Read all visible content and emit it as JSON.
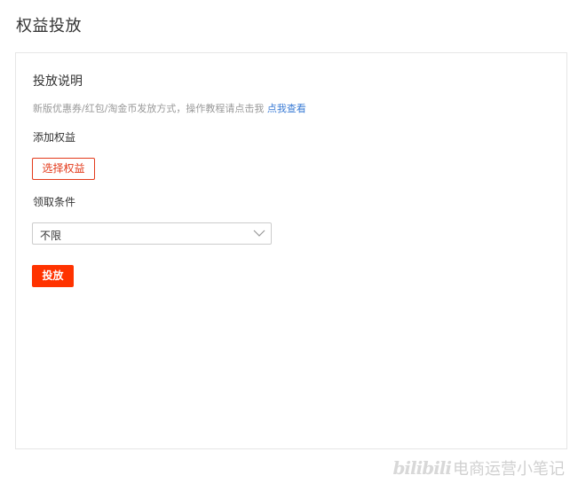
{
  "page": {
    "title": "权益投放"
  },
  "card": {
    "section_title": "投放说明",
    "description": "新版优惠券/红包/淘金币发放方式，操作教程请点击我 ",
    "description_link": "点我查看",
    "add_rights_label": "添加权益",
    "select_rights_button": "选择权益",
    "condition_label": "领取条件",
    "condition_select": {
      "selected": "不限"
    },
    "submit_button": "投放"
  },
  "watermark": {
    "logo": "bilibili",
    "text": "电商运营小笔记"
  },
  "colors": {
    "accent_red": "#ff3300",
    "border_red": "#e33a1b",
    "link_blue": "#3a7bd5"
  },
  "icons": {
    "select_arrow": "chevron-down-icon"
  }
}
